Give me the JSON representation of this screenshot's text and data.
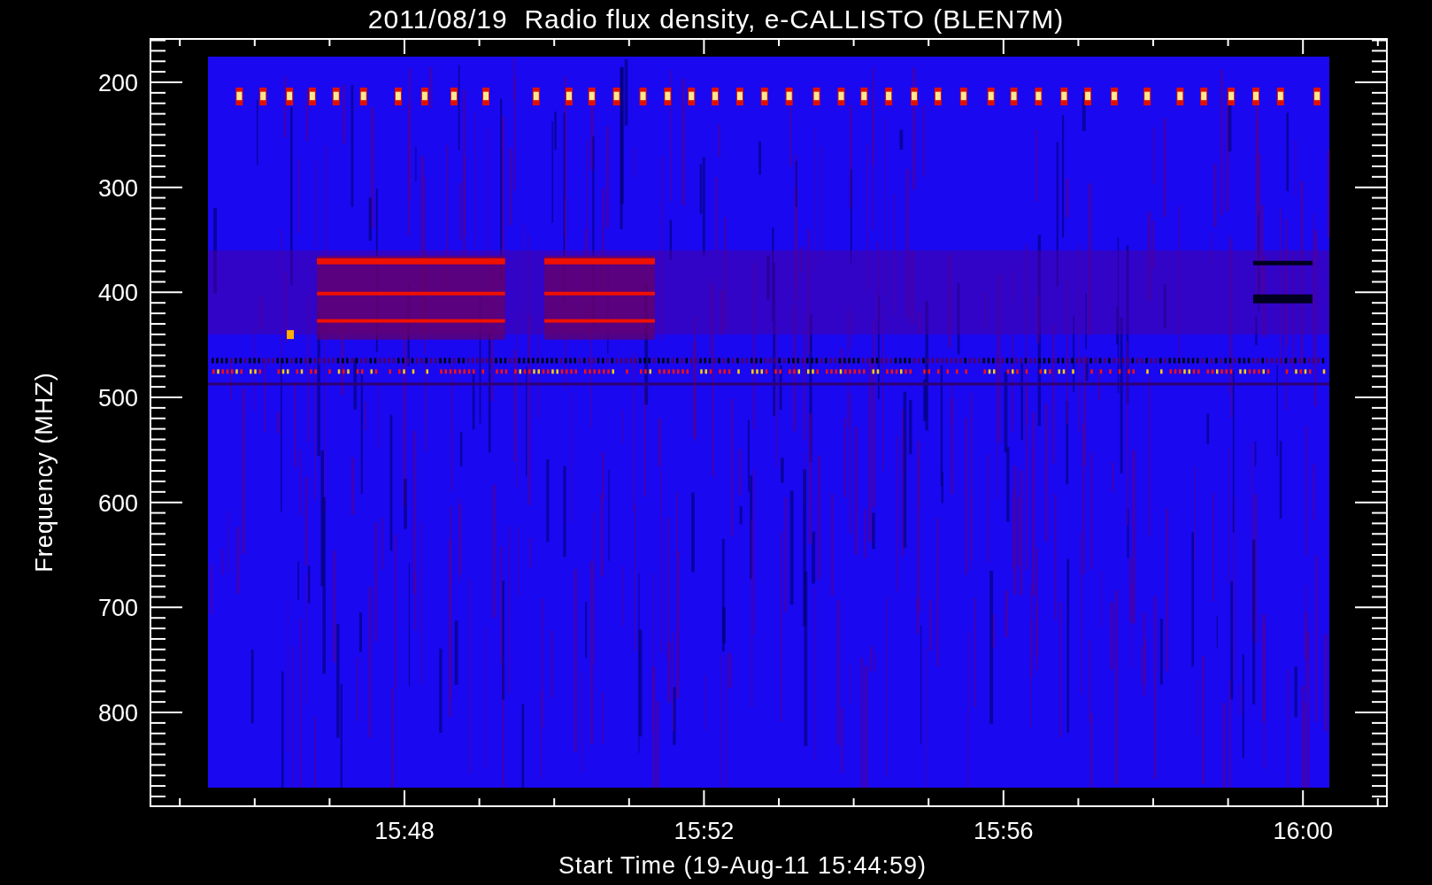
{
  "title": "2011/08/19  Radio flux density, e-CALLISTO (BLEN7M)",
  "y_axis": {
    "label": "Frequency (MHZ)",
    "ticks": [
      "200",
      "300",
      "400",
      "500",
      "600",
      "700",
      "800"
    ]
  },
  "x_axis": {
    "label": "Start Time (19-Aug-11 15:44:59)",
    "ticks": [
      "15:48",
      "15:52",
      "15:56",
      "16:00"
    ]
  }
}
